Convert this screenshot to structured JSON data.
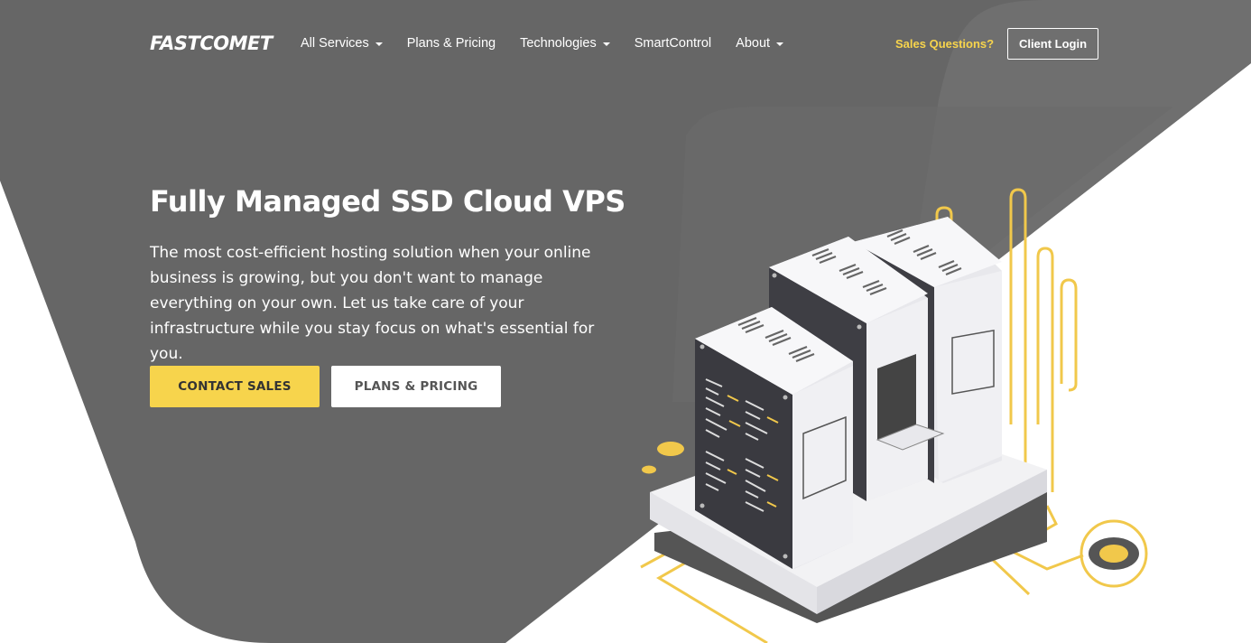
{
  "colors": {
    "background_dark": "#666666",
    "background_light": "#ffffff",
    "accent_yellow": "#f7d44c",
    "text_white": "#ffffff"
  },
  "header": {
    "logo": "FASTCOMET",
    "nav": [
      {
        "label": "All Services",
        "has_dropdown": true
      },
      {
        "label": "Plans & Pricing",
        "has_dropdown": false
      },
      {
        "label": "Technologies",
        "has_dropdown": true
      },
      {
        "label": "SmartControl",
        "has_dropdown": false
      },
      {
        "label": "About",
        "has_dropdown": true
      }
    ],
    "sales_questions": "Sales Questions?",
    "client_login": "Client Login"
  },
  "hero": {
    "title": "Fully Managed SSD Cloud VPS",
    "description": "The most cost-efficient hosting solution when your online business is growing, but you don't want to manage everything on your own. Let us take care of your infrastructure while you stay focus on what's essential for you.",
    "contact_button": "CONTACT SALES",
    "plans_button": "PLANS & PRICING"
  },
  "illustration": {
    "icon": "server-rack-illustration"
  }
}
